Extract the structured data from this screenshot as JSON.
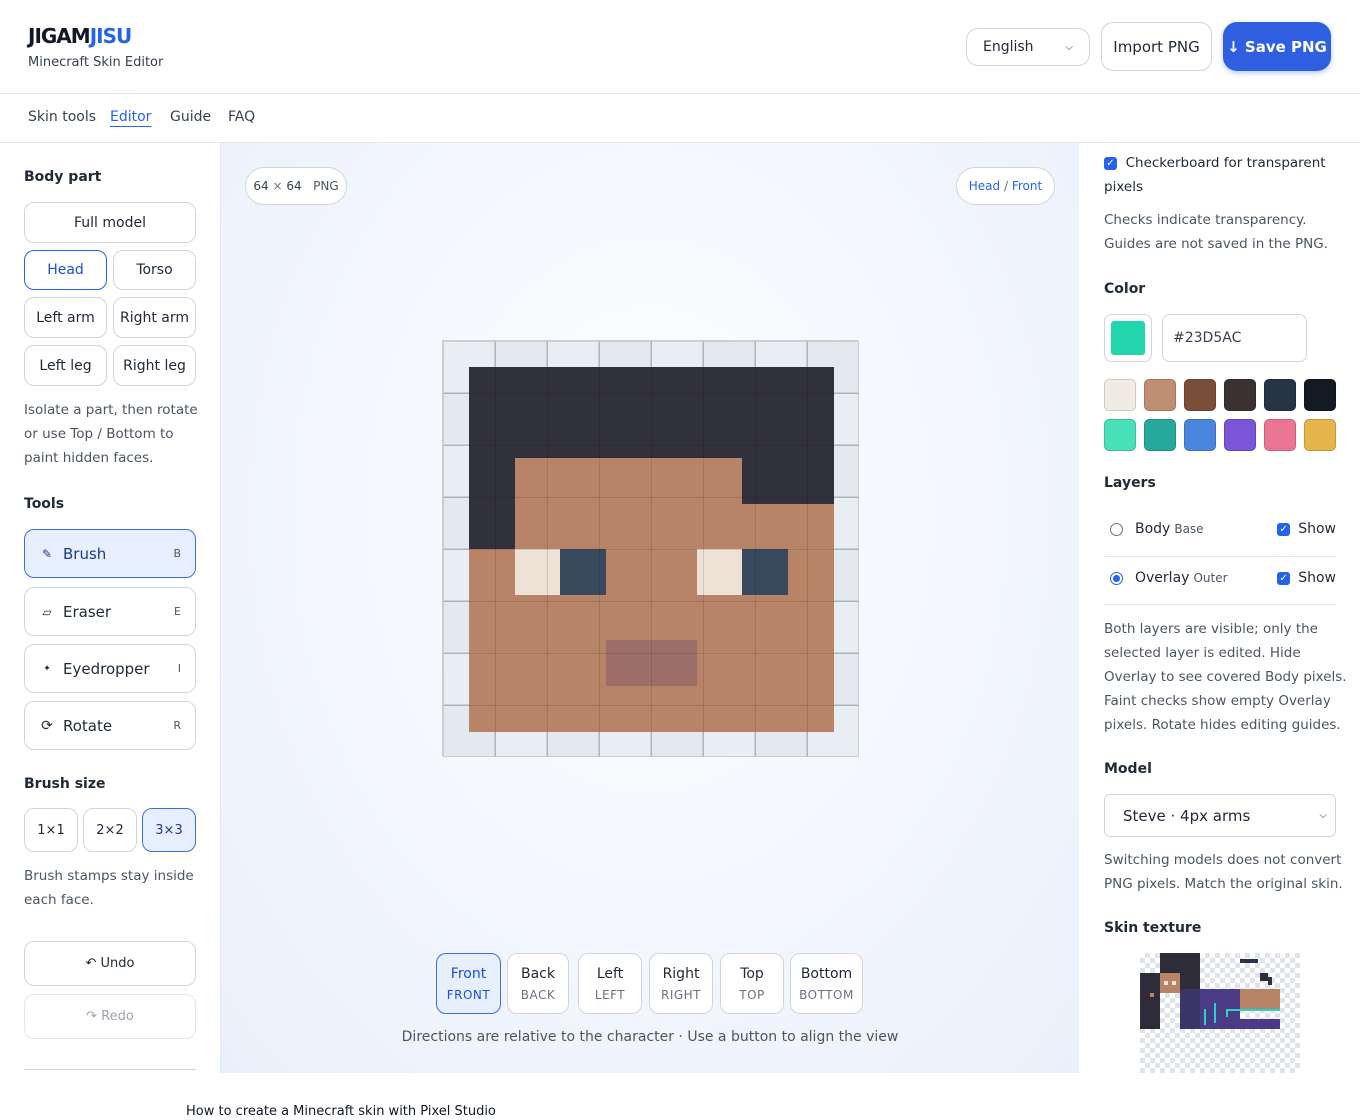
{
  "header": {
    "logo_part1": "JIGAM",
    "logo_part2": "JISU",
    "subtitle": "Minecraft Skin Editor",
    "language": "English",
    "import_label": "Import PNG",
    "save_label": "↓ Save PNG"
  },
  "nav": [
    "Skin tools",
    "Editor",
    "Guide",
    "FAQ"
  ],
  "left": {
    "body_part_title": "Body part",
    "full_model": "Full model",
    "parts": [
      "Head",
      "Torso",
      "Left arm",
      "Right arm",
      "Left leg",
      "Right leg"
    ],
    "selected_part": "Head",
    "isolate_hint": [
      "Isolate a part, then rotate",
      "or use Top / Bottom to",
      "paint hidden faces."
    ],
    "tools_title": "Tools",
    "tools": [
      {
        "label": "Brush",
        "key": "B",
        "icon": "brush-icon"
      },
      {
        "label": "Eraser",
        "key": "E",
        "icon": "eraser-icon"
      },
      {
        "label": "Eyedropper",
        "key": "I",
        "icon": "eyedropper-icon"
      },
      {
        "label": "Rotate",
        "key": "R",
        "icon": "rotate-icon"
      }
    ],
    "brush_size_title": "Brush size",
    "sizes": [
      "1×1",
      "2×2",
      "3×3"
    ],
    "selected_size": "3×3",
    "brush_hint": [
      "Brush stamps stay inside",
      "each face."
    ],
    "undo": "↶ Undo",
    "redo": "↷ Redo"
  },
  "canvas": {
    "size_w": "64",
    "size_x": "×",
    "size_h": "64",
    "format": "PNG",
    "view_part": "Head",
    "view_sep": "/",
    "view_face": "Front",
    "directions": [
      {
        "label": "Front",
        "sub": "FRONT"
      },
      {
        "label": "Back",
        "sub": "BACK"
      },
      {
        "label": "Left",
        "sub": "LEFT"
      },
      {
        "label": "Right",
        "sub": "RIGHT"
      },
      {
        "label": "Top",
        "sub": "TOP"
      },
      {
        "label": "Bottom",
        "sub": "BOTTOM"
      }
    ],
    "selected_direction": "Front",
    "direction_note": "Directions are relative to the character · Use a button to align the view"
  },
  "right": {
    "checkerboard_label": "Checkerboard for transparent",
    "checkerboard_label2": "pixels",
    "checkerboard_checked": true,
    "transparency_note": [
      "Checks indicate transparency.",
      "Guides are not saved in the PNG."
    ],
    "color_title": "Color",
    "current_color": "#23D5AC",
    "current_color_hex": "#23D5AC",
    "palette": [
      "#f1ebe2",
      "#c08e72",
      "#7a4f3a",
      "#3b3130",
      "#263446",
      "#141a24",
      "#49dfb8",
      "#27a89c",
      "#4a86e0",
      "#7a55d8",
      "#ec7593",
      "#e6b44a"
    ],
    "layers_title": "Layers",
    "layers": [
      {
        "name": "Body",
        "sub": "Base",
        "selected": false,
        "show": "Show"
      },
      {
        "name": "Overlay",
        "sub": "Outer",
        "selected": true,
        "show": "Show"
      }
    ],
    "layers_note": [
      "Both layers are visible; only the",
      "selected layer is edited. Hide",
      "Overlay to see covered Body pixels.",
      "Faint checks show empty Overlay",
      "pixels. Rotate hides editing guides."
    ],
    "model_title": "Model",
    "model_value": "Steve · 4px arms",
    "model_note": [
      "Switching models does not convert",
      "PNG pixels. Match the original skin."
    ],
    "texture_title": "Skin texture"
  },
  "footer": {
    "text": "How to create a Minecraft skin with Pixel Studio"
  },
  "face_colors": {
    "hair": "#31303d",
    "hair_dark": "#2b2a36",
    "skin": "#b88468",
    "skin_dark": "#ad7a5e",
    "eye_white": "#eee2d6",
    "eye_blue": "#394a5e",
    "mouth": "#9b6f68"
  }
}
